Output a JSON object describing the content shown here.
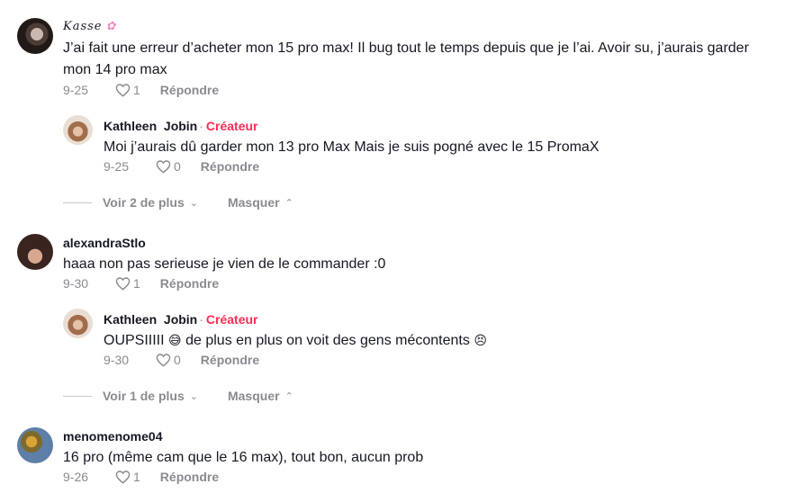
{
  "comments": [
    {
      "username": "Kasse",
      "username_suffix": "✿",
      "text": "J’ai fait une erreur d’acheter mon 15 pro max! Il bug tout le temps depuis que je l’ai. Avoir su, j’aurais garder mon 14 pro max",
      "date": "9-25",
      "likes": "1",
      "reply_label": "Répondre",
      "reply": {
        "username": "Kathleen  Jobin",
        "separator": "·",
        "badge": "Créateur",
        "text": "Moi j’aurais dû garder mon 13 pro Max Mais je suis pogné avec le 15 PromaX",
        "date": "9-25",
        "likes": "0",
        "reply_label": "Répondre"
      },
      "more_label": "Voir 2 de plus",
      "hide_label": "Masquer"
    },
    {
      "username": "alexandraStlo",
      "text": "haaa non pas serieuse je vien de le commander :0",
      "date": "9-30",
      "likes": "1",
      "reply_label": "Répondre",
      "reply": {
        "username": "Kathleen  Jobin",
        "separator": "·",
        "badge": "Créateur",
        "text_before": "OUPSIIIII",
        "emoji1": "😅",
        "text_mid": "de plus en plus on voit des gens mécontents",
        "emoji2": "😣",
        "date": "9-30",
        "likes": "0",
        "reply_label": "Répondre"
      },
      "more_label": "Voir 1 de plus",
      "hide_label": "Masquer"
    },
    {
      "username": "menomenome04",
      "text": "16 pro (même cam que le 16 max), tout bon, aucun prob",
      "date": "9-26",
      "likes": "1",
      "reply_label": "Répondre"
    }
  ],
  "colors": {
    "text": "#161823",
    "muted": "#8a8b91",
    "creator_badge": "#fe2c55"
  },
  "icons": {
    "like": "heart-outline-icon",
    "expand": "chevron-down-icon",
    "collapse": "chevron-up-icon"
  }
}
